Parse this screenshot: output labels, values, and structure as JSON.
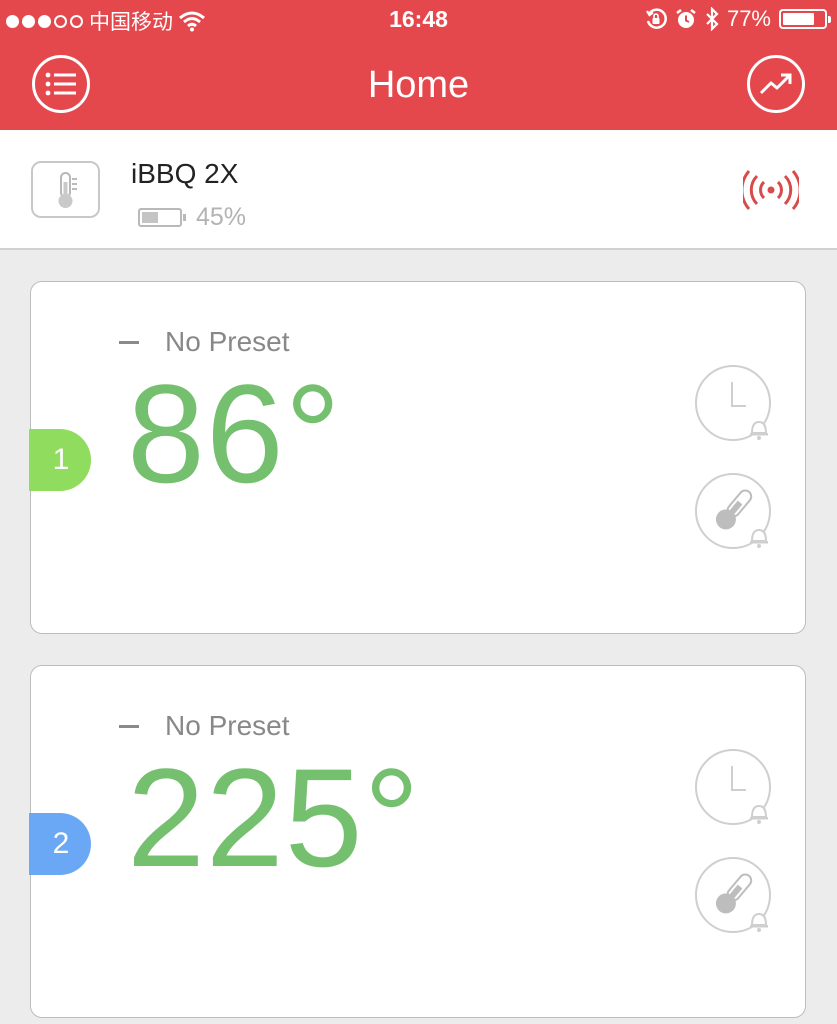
{
  "status_bar": {
    "carrier": "中国移动",
    "time": "16:48",
    "battery_percent": "77%",
    "battery_level": 0.77
  },
  "nav": {
    "title": "Home",
    "left_icon": "menu-icon",
    "right_icon": "chart-trend-icon"
  },
  "device": {
    "name": "iBBQ 2X",
    "battery_text": "45%",
    "battery_level": 0.45,
    "connection_icon": "signal-broadcast-icon"
  },
  "colors": {
    "header": "#e4484d",
    "temperature": "#74c06f",
    "probe_1": "#8fdc5f",
    "probe_2": "#6aa8f5"
  },
  "probes": [
    {
      "number": "1",
      "preset": "No Preset",
      "temperature": "86°",
      "color": "#8fdc5f"
    },
    {
      "number": "2",
      "preset": "No Preset",
      "temperature": "225°",
      "color": "#6aa8f5"
    }
  ]
}
